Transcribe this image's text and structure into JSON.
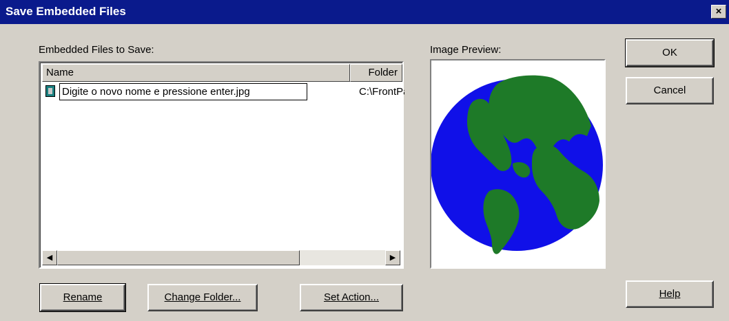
{
  "window": {
    "title": "Save Embedded Files",
    "close_label": "×"
  },
  "files_label": "Embedded Files to Save:",
  "preview_label": "Image Preview:",
  "table": {
    "columns": [
      "Name",
      "Folder"
    ],
    "rows": [
      {
        "name": "Digite o novo nome e pressione enter.jpg",
        "folder": "C:\\FrontPage ..."
      }
    ]
  },
  "scrollbar": {
    "left_arrow": "◀",
    "right_arrow": "▶"
  },
  "buttons": {
    "ok": "OK",
    "cancel": "Cancel",
    "help": "Help",
    "rename": "Rename",
    "change_folder": "Change Folder...",
    "set_action": "Set Action..."
  },
  "colors": {
    "ocean": "#1010e8",
    "land": "#1e7a28",
    "titlebar": "#0a1a8c",
    "face": "#d4d0c8"
  }
}
